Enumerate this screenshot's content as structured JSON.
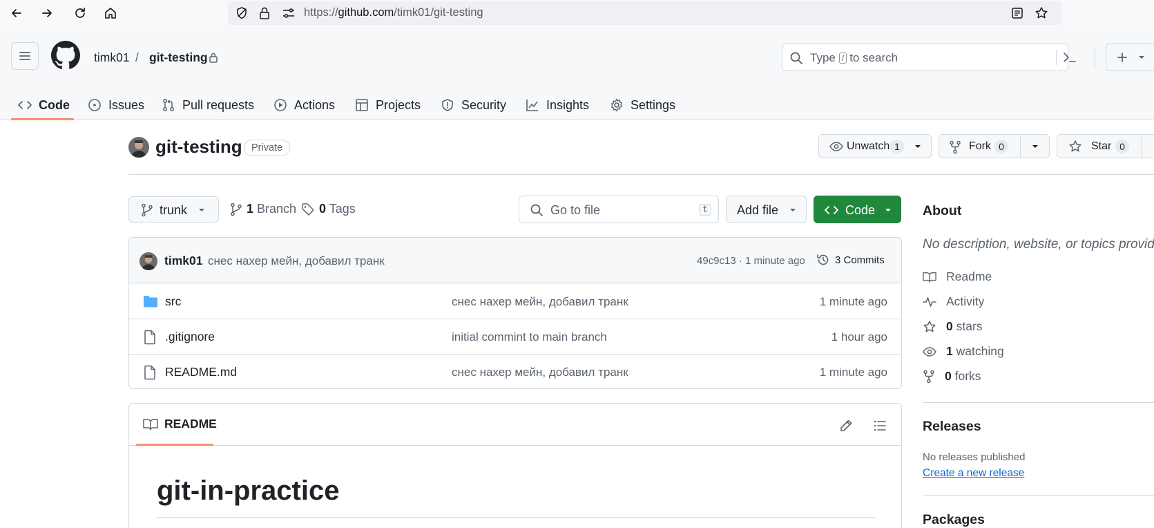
{
  "browser": {
    "url_prefix": "https://",
    "url_host": "github.com",
    "url_path": "/timk01/git-testing"
  },
  "header": {
    "owner": "timk01",
    "separator": "/",
    "repo": "git-testing",
    "search_prefix": "Type",
    "search_key": "/",
    "search_suffix": "to search"
  },
  "tabs": [
    {
      "label": "Code",
      "icon": "code-icon"
    },
    {
      "label": "Issues",
      "icon": "issue-opened-icon"
    },
    {
      "label": "Pull requests",
      "icon": "git-pull-request-icon"
    },
    {
      "label": "Actions",
      "icon": "play-icon"
    },
    {
      "label": "Projects",
      "icon": "table-icon"
    },
    {
      "label": "Security",
      "icon": "shield-icon"
    },
    {
      "label": "Insights",
      "icon": "graph-icon"
    },
    {
      "label": "Settings",
      "icon": "gear-icon"
    }
  ],
  "repo": {
    "title": "git-testing",
    "visibility": "Private",
    "unwatch_label": "Unwatch",
    "watch_count": "1",
    "fork_label": "Fork",
    "fork_count": "0",
    "star_label": "Star",
    "star_count": "0"
  },
  "branch_bar": {
    "branch": "trunk",
    "branch_count": "1",
    "branch_label": "Branch",
    "tag_count": "0",
    "tag_label": "Tags",
    "goto_placeholder": "Go to file",
    "goto_key": "t",
    "add_file": "Add file",
    "code": "Code"
  },
  "latest_commit": {
    "author": "timk01",
    "message": "снес нахер мейн, добавил транк",
    "meta": "49c9c13 · 1 minute ago",
    "commits": "3 Commits"
  },
  "files": [
    {
      "name": "src",
      "type": "folder",
      "message": "снес нахер мейн, добавил транк",
      "time": "1 minute ago"
    },
    {
      "name": ".gitignore",
      "type": "file",
      "message": "initial commint to main branch",
      "time": "1 hour ago"
    },
    {
      "name": "README.md",
      "type": "file",
      "message": "снес нахер мейн, добавил транк",
      "time": "1 minute ago"
    }
  ],
  "readme": {
    "tab_label": "README",
    "heading": "git-in-practice"
  },
  "sidebar": {
    "about_title": "About",
    "about_desc": "No description, website, or topics provid",
    "readme": "Readme",
    "activity": "Activity",
    "stars_count": "0",
    "stars_label": "stars",
    "watching_count": "1",
    "watching_label": "watching",
    "forks_count": "0",
    "forks_label": "forks",
    "releases_title": "Releases",
    "no_releases": "No releases published",
    "create_release": "Create a new release",
    "packages_title": "Packages"
  },
  "colors": {
    "accent_underline": "#fd8c73",
    "primary_green": "#1f883d",
    "link_blue": "#0969da",
    "folder_blue": "#54aeff"
  }
}
